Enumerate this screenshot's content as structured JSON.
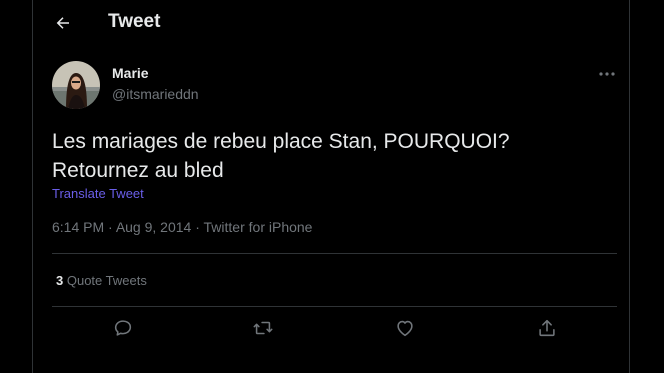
{
  "header": {
    "title": "Tweet",
    "back_icon": "arrow-left-icon"
  },
  "tweet": {
    "author": {
      "name": "Marie",
      "handle": "@itsmarieddn"
    },
    "text_line1": "Les mariages de rebeu place Stan, POURQUOI?",
    "text_line2": "Retournez au bled",
    "translate_label": "Translate Tweet",
    "time": "6:14 PM",
    "date": "Aug 9, 2014",
    "separator": " · ",
    "source": "Twitter for iPhone",
    "quote_count": "3",
    "quote_label": "Quote Tweets"
  },
  "actions": [
    "reply-icon",
    "retweet-icon",
    "like-icon",
    "share-icon"
  ],
  "colors": {
    "background": "#000000",
    "text": "#e7e9ea",
    "secondary": "#71767b",
    "link": "#6a5ee8",
    "border": "#2f3336"
  }
}
